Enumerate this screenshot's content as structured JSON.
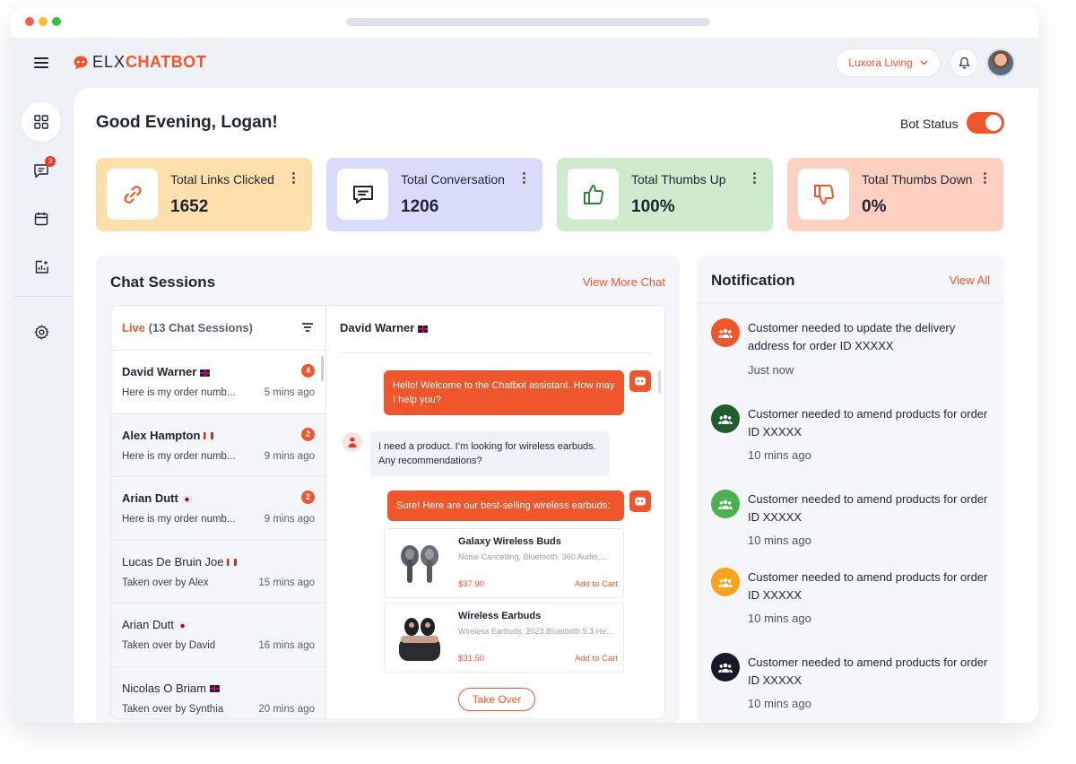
{
  "header": {
    "logo_prefix": "ELX",
    "logo_suffix": "CHATBOT",
    "brand_selector": "Luxora Living"
  },
  "sidebar": {
    "chat_badge": "3"
  },
  "main": {
    "greeting": "Good Evening, Logan!",
    "bot_status_label": "Bot Status",
    "bot_status_on": true
  },
  "stats": [
    {
      "label": "Total Links Clicked",
      "value": "1652",
      "color": "#fde0ac"
    },
    {
      "label": "Total Conversation",
      "value": "1206",
      "color": "#d9dbfb"
    },
    {
      "label": "Total Thumbs Up",
      "value": "100%",
      "color": "#cfeacc"
    },
    {
      "label": "Total Thumbs Down",
      "value": "0%",
      "color": "#fdd0c1"
    }
  ],
  "chat_sessions": {
    "title": "Chat Sessions",
    "view_more": "View More Chat",
    "live_label": "Live",
    "count_label": "(13 Chat Sessions)",
    "sessions": [
      {
        "name": "David Warner",
        "flag": "uk",
        "preview": "Here is my order numb...",
        "time": "5 mins ago",
        "count": "4"
      },
      {
        "name": "Alex Hampton",
        "flag": "ca",
        "preview": "Here is my order numb...",
        "time": "9 mins ago",
        "count": "2"
      },
      {
        "name": "Arian Dutt",
        "flag": "jp",
        "preview": "Here is my order numb...",
        "time": "9 mins ago",
        "count": "2"
      },
      {
        "name": "Lucas De Bruin Joe",
        "flag": "ca",
        "preview": "Taken over by Alex",
        "time": "15 mins ago",
        "count": ""
      },
      {
        "name": "Arian Dutt",
        "flag": "jp",
        "preview": "Taken over by David",
        "time": "16 mins ago",
        "count": ""
      },
      {
        "name": "Nicolas O Briam",
        "flag": "uk",
        "preview": "Taken over by Synthia",
        "time": "20 mins ago",
        "count": ""
      }
    ]
  },
  "conversation": {
    "name": "David Warner",
    "msg1": "Hello! Welcome to the Chatbot assistant. How may I help you?",
    "msg2": "I need a product. I’m looking for wireless earbuds. Any recommendations?",
    "msg3": "Sure! Here are our best-selling wireless  earbuds:",
    "products": [
      {
        "name": "Galaxy Wireless Buds",
        "desc": "Noise Cancelling, Bluetooth, 360 Audio,...",
        "price": "$37.90",
        "cta": "Add to Cart"
      },
      {
        "name": "Wireless Earbuds",
        "desc": "Wireless Earbuds, 2023 Bluetooth 5.3 He...",
        "price": "$31.50",
        "cta": "Add to Cart"
      }
    ],
    "takeover": "Take Over"
  },
  "notifications": {
    "title": "Notification",
    "view_all": "View All",
    "items": [
      {
        "text": "Customer needed to update the delivery address for order ID XXXXX",
        "time": "Just now",
        "color": "#f0562b"
      },
      {
        "text": "Customer needed to amend products for order ID XXXXX",
        "time": "10 mins ago",
        "color": "#1f5e2c"
      },
      {
        "text": "Customer needed to amend products for order ID XXXXX",
        "time": "10 mins ago",
        "color": "#4caf50"
      },
      {
        "text": "Customer needed to amend products for order ID XXXXX",
        "time": "10 mins ago",
        "color": "#f9a31a"
      },
      {
        "text": "Customer needed to amend products for order ID XXXXX",
        "time": "10 mins ago",
        "color": "#141a26"
      }
    ]
  },
  "colors": {
    "accent": "#f0562b"
  }
}
